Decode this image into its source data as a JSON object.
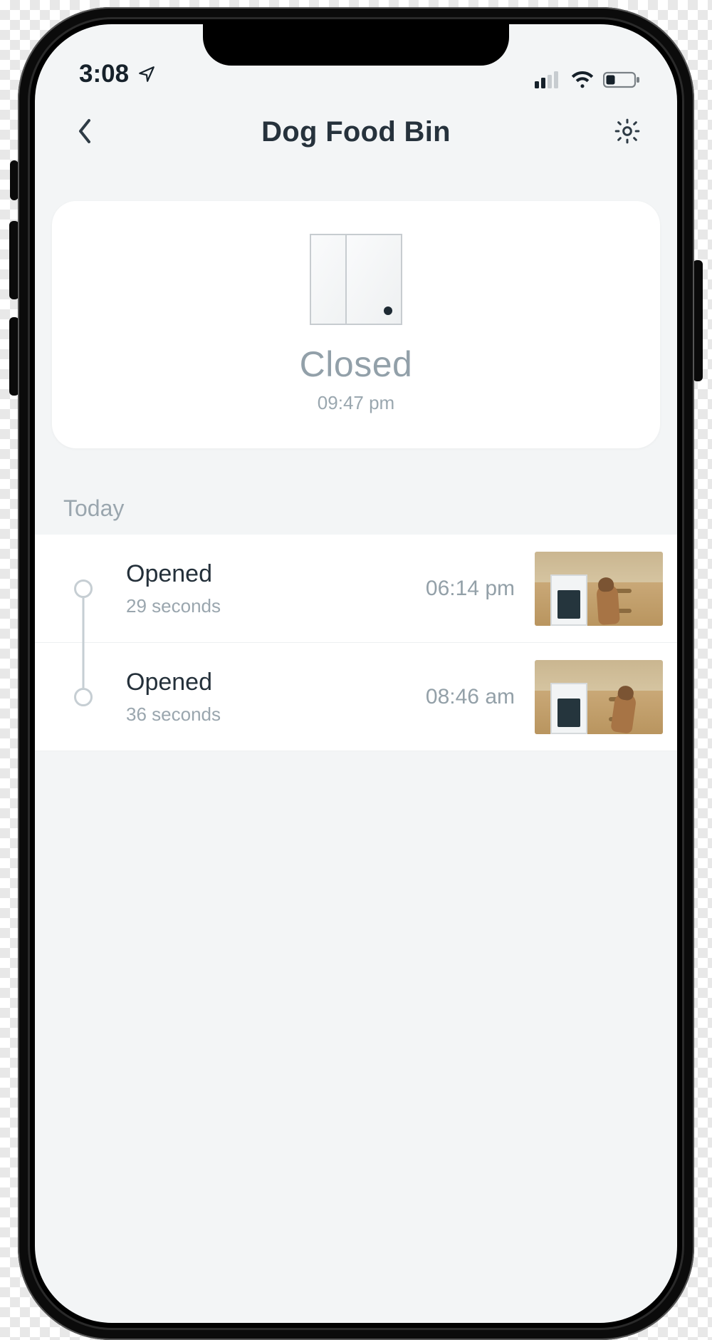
{
  "status_bar": {
    "time": "3:08",
    "location_icon": "location-arrow",
    "signal_bars_active": 2,
    "signal_bars_total": 4,
    "wifi": "full",
    "battery_level": "low"
  },
  "header": {
    "back_icon": "chevron-left",
    "title": "Dog Food Bin",
    "settings_icon": "gear"
  },
  "device_status": {
    "illustration": "contact-sensor-closed",
    "state_label": "Closed",
    "state_time": "09:47 pm"
  },
  "history": {
    "section_label": "Today",
    "events": [
      {
        "title": "Opened",
        "duration": "29 seconds",
        "time": "06:14 pm",
        "thumbnail_desc": "kitchen camera snapshot with dog near stove"
      },
      {
        "title": "Opened",
        "duration": "36 seconds",
        "time": "08:46 am",
        "thumbnail_desc": "kitchen camera snapshot with dog near counter"
      }
    ]
  }
}
